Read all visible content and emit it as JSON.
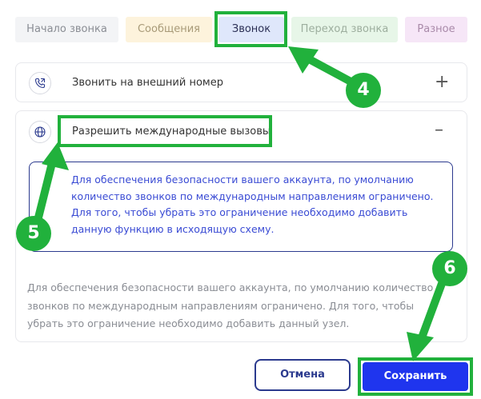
{
  "tabs": [
    {
      "label": "Начало звонка"
    },
    {
      "label": "Сообщения"
    },
    {
      "label": "Звонок"
    },
    {
      "label": "Переход звонка"
    },
    {
      "label": "Разное"
    }
  ],
  "section_external": {
    "label": "Звонить на внешний номер",
    "icon": "phone-icon",
    "toggle": "+"
  },
  "section_international": {
    "label": "Разрешить международные вызовы",
    "icon": "globe-icon",
    "toggle": "–"
  },
  "info_text": "Для обеспечения безопасности вашего аккаунта, по умолчанию количество звонков по международным направлениям ограничено. Для того, чтобы убрать это ограничение необходимо добавить данную функцию в исходящую схему.",
  "description": "Для обеспечения безопасности вашего аккаунта, по умолчанию количество звонков по международным направлениям ограничено. Для того, чтобы убрать это ограничение необходимо добавить данный узел.",
  "buttons": {
    "cancel": "Отмена",
    "save": "Сохранить"
  },
  "annotations": {
    "step4": "4",
    "step5": "5",
    "step6": "6",
    "color": "#21b13c"
  },
  "colors": {
    "accent": "#1f35ee",
    "dark_blue": "#2b3a8e",
    "info_text": "#3a4bd4"
  }
}
